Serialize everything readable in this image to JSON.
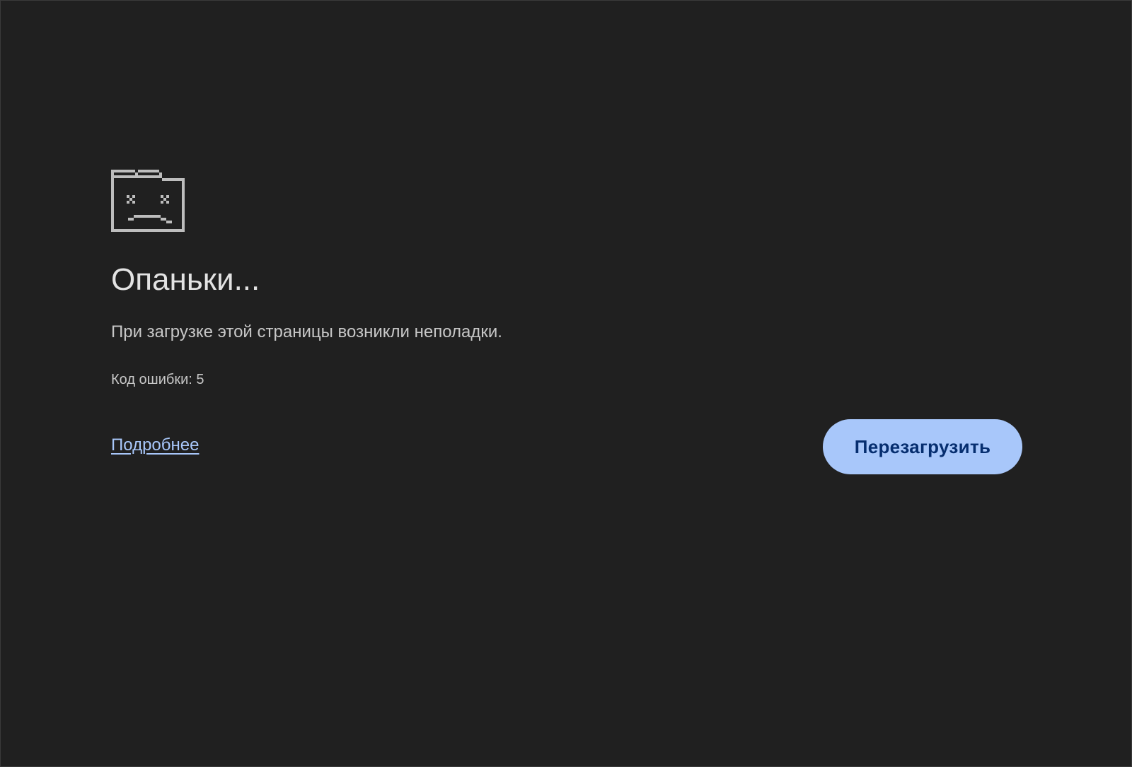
{
  "error_page": {
    "icon": "sad-tab-icon",
    "heading": "Опаньки...",
    "message": "При загрузке этой страницы возникли неполадки.",
    "error_code": "Код ошибки: 5",
    "learn_more_label": "Подробнее",
    "reload_label": "Перезагрузить"
  },
  "colors": {
    "background": "#202020",
    "text_primary": "#e3e3e3",
    "text_secondary": "#c7c7c7",
    "link": "#a8c7fa",
    "button_background": "#a8c7fa",
    "button_text": "#062e6f",
    "icon": "#bdbdbd"
  }
}
